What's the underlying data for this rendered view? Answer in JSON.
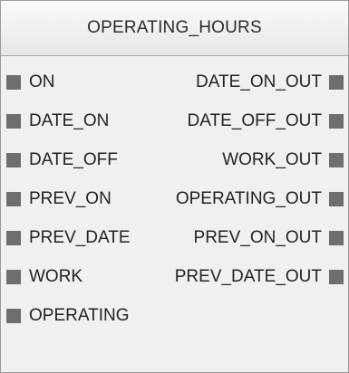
{
  "block": {
    "title": "OPERATING_HOURS",
    "inputs": [
      {
        "label": "ON"
      },
      {
        "label": "DATE_ON"
      },
      {
        "label": "DATE_OFF"
      },
      {
        "label": "PREV_ON"
      },
      {
        "label": "PREV_DATE"
      },
      {
        "label": "WORK"
      },
      {
        "label": "OPERATING"
      }
    ],
    "outputs": [
      {
        "label": "DATE_ON_OUT"
      },
      {
        "label": "DATE_OFF_OUT"
      },
      {
        "label": "WORK_OUT"
      },
      {
        "label": "OPERATING_OUT"
      },
      {
        "label": "PREV_ON_OUT"
      },
      {
        "label": "PREV_DATE_OUT"
      }
    ]
  },
  "colors": {
    "pin": "#6e6e6e",
    "body": "#f0f0f0",
    "border": "#9a9a9a"
  }
}
